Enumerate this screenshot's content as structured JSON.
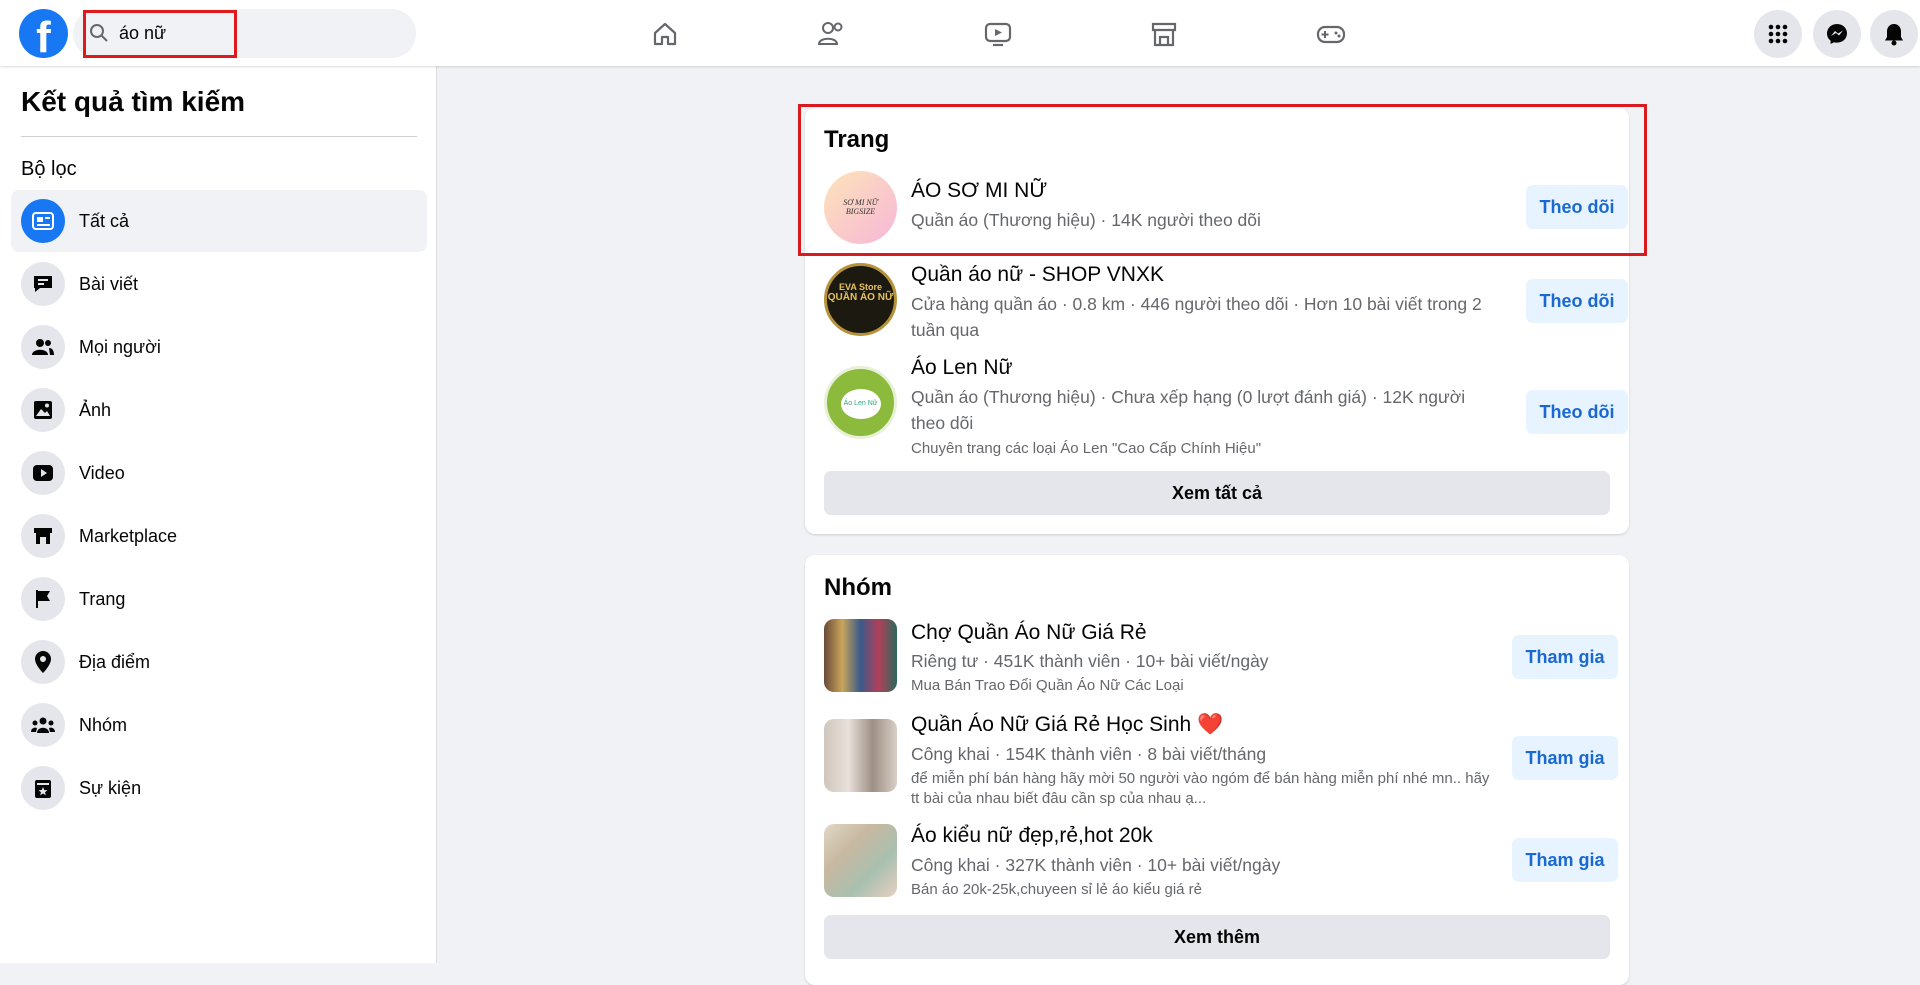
{
  "topbar": {
    "logo": "f",
    "search_value": "áo nữ",
    "nav_icons": [
      "home-icon",
      "friends-icon",
      "watch-icon",
      "marketplace-icon",
      "gaming-icon"
    ],
    "right_icons": [
      "menu-grid-icon",
      "messenger-icon",
      "notifications-icon"
    ]
  },
  "sidebar": {
    "title": "Kết quả tìm kiếm",
    "filter_label": "Bộ lọc",
    "items": [
      {
        "label": "Tất cả",
        "icon": "all-results-icon",
        "selected": true
      },
      {
        "label": "Bài viết",
        "icon": "posts-icon"
      },
      {
        "label": "Mọi người",
        "icon": "people-icon"
      },
      {
        "label": "Ảnh",
        "icon": "photos-icon"
      },
      {
        "label": "Video",
        "icon": "video-icon"
      },
      {
        "label": "Marketplace",
        "icon": "marketplace-icon"
      },
      {
        "label": "Trang",
        "icon": "flag-icon"
      },
      {
        "label": "Địa điểm",
        "icon": "location-icon"
      },
      {
        "label": "Nhóm",
        "icon": "groups-icon"
      },
      {
        "label": "Sự kiện",
        "icon": "events-icon"
      }
    ]
  },
  "pages": {
    "title": "Trang",
    "see_all": "Xem tất cả",
    "items": [
      {
        "name": "ÁO SƠ MI NỮ",
        "sub": "Quần áo (Thương hiệu) · 14K người theo dõi",
        "button": "Theo dõi"
      },
      {
        "name": "Quần áo nữ - SHOP VNXK",
        "sub": "Cửa hàng quần áo · 0.8 km · 446 người theo dõi · Hơn 10 bài viết trong 2 tuần qua",
        "button": "Theo dõi"
      },
      {
        "name": "Áo Len Nữ",
        "sub": "Quần áo (Thương hiệu) · Chưa xếp hạng (0 lượt đánh giá) · 12K người theo dõi",
        "desc": "Chuyên trang các loại Áo Len \"Cao Cấp Chính Hiệu\"",
        "button": "Theo dõi"
      }
    ]
  },
  "groups": {
    "title": "Nhóm",
    "see_more": "Xem thêm",
    "items": [
      {
        "name": "Chợ Quần Áo Nữ Giá Rẻ",
        "sub": "Riêng tư · 451K thành viên · 10+ bài viết/ngày",
        "desc": "Mua Bán Trao Đổi Quần Áo Nữ Các Loại",
        "button": "Tham gia"
      },
      {
        "name": "Quần Áo Nữ Giá Rẻ Học Sinh",
        "emoji": "❤️",
        "sub": "Công khai · 154K thành viên · 8 bài viết/tháng",
        "desc": "để miễn phí bán hàng hãy mời 50 người vào ngóm để bán hàng miễn phí nhé mn.. hãy tt bài của nhau biết đâu cần sp của nhau ạ...",
        "button": "Tham gia"
      },
      {
        "name": "Áo kiểu nữ đẹp,rẻ,hot 20k",
        "sub": "Công khai · 327K thành viên · 10+ bài viết/ngày",
        "desc": "Bán áo 20k-25k,chuyeen sỉ lẻ áo kiểu giá rẻ",
        "button": "Tham gia"
      }
    ]
  },
  "colors": {
    "brand": "#1877f2",
    "highlight": "#d81b1f",
    "button_text": "#1a69d0"
  }
}
